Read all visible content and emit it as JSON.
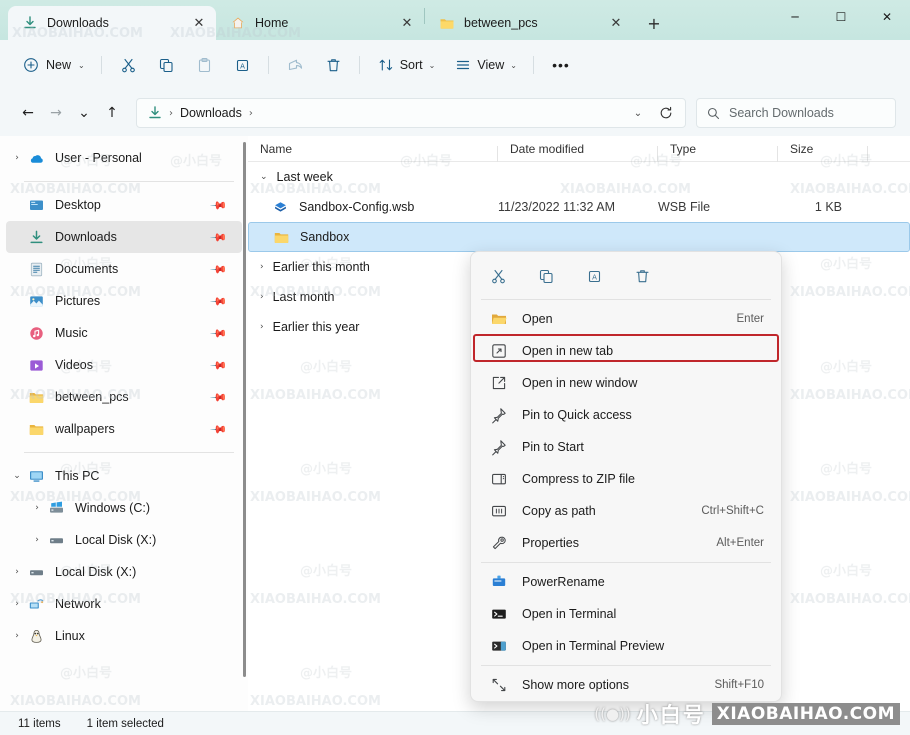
{
  "window": {
    "minimize_label": "─",
    "maximize_label": "☐",
    "close_label": "✕"
  },
  "tabs": [
    {
      "label": "Downloads",
      "icon": "download-icon",
      "active": true,
      "close_label": "✕"
    },
    {
      "label": "Home",
      "icon": "home-icon",
      "active": false,
      "close_label": "✕"
    },
    {
      "label": "between_pcs",
      "icon": "folder-icon",
      "active": false,
      "close_label": "✕"
    }
  ],
  "new_tab_label": "+",
  "toolbar": {
    "new_label": "New",
    "new_chevron": "⌄",
    "cut_label": "Cut",
    "copy_label": "Copy",
    "paste_label": "Paste",
    "rename_label": "Rename",
    "share_label": "Share",
    "delete_label": "Delete",
    "sort_label": "Sort",
    "sort_chevron": "⌄",
    "view_label": "View",
    "view_chevron": "⌄",
    "more_label": "•••"
  },
  "navbar": {
    "back_label": "←",
    "forward_label": "→",
    "recent_label": "⌄",
    "up_label": "↑",
    "refresh_label": "↻",
    "dropdown_label": "⌄"
  },
  "address": {
    "icon": "download-icon",
    "separator": "›",
    "crumbs": [
      "Downloads"
    ],
    "trailing_separator": "›"
  },
  "search": {
    "placeholder": "Search Downloads",
    "icon": "search-icon"
  },
  "sidebar": {
    "items": [
      {
        "label": "User - Personal",
        "icon": "onedrive-icon",
        "expander": "›",
        "indent": 0,
        "pinned": false,
        "selected": false
      },
      {
        "divider": true
      },
      {
        "label": "Desktop",
        "icon": "desktop-icon",
        "expander": "",
        "indent": 1,
        "pinned": true,
        "selected": false
      },
      {
        "label": "Downloads",
        "icon": "download-icon",
        "expander": "",
        "indent": 1,
        "pinned": true,
        "selected": true
      },
      {
        "label": "Documents",
        "icon": "documents-icon",
        "expander": "",
        "indent": 1,
        "pinned": true,
        "selected": false
      },
      {
        "label": "Pictures",
        "icon": "pictures-icon",
        "expander": "",
        "indent": 1,
        "pinned": true,
        "selected": false
      },
      {
        "label": "Music",
        "icon": "music-icon",
        "expander": "",
        "indent": 1,
        "pinned": true,
        "selected": false
      },
      {
        "label": "Videos",
        "icon": "videos-icon",
        "expander": "",
        "indent": 1,
        "pinned": true,
        "selected": false
      },
      {
        "label": "between_pcs",
        "icon": "folder-icon",
        "expander": "",
        "indent": 1,
        "pinned": true,
        "selected": false
      },
      {
        "label": "wallpapers",
        "icon": "folder-icon",
        "expander": "",
        "indent": 1,
        "pinned": true,
        "selected": false
      },
      {
        "divider": true
      },
      {
        "label": "This PC",
        "icon": "thispc-icon",
        "expander": "⌄",
        "indent": 0,
        "pinned": false,
        "selected": false
      },
      {
        "label": "Windows (C:)",
        "icon": "windrive-icon",
        "expander": "›",
        "indent": 1,
        "pinned": false,
        "selected": false
      },
      {
        "label": "Local Disk (X:)",
        "icon": "drive-icon",
        "expander": "›",
        "indent": 1,
        "pinned": false,
        "selected": false
      },
      {
        "label": "Local Disk (X:)",
        "icon": "drive-icon",
        "expander": "›",
        "indent": 0,
        "pinned": false,
        "selected": false
      },
      {
        "label": "Network",
        "icon": "network-icon",
        "expander": "›",
        "indent": 0,
        "pinned": false,
        "selected": false
      },
      {
        "label": "Linux",
        "icon": "linux-icon",
        "expander": "›",
        "indent": 0,
        "pinned": false,
        "selected": false
      }
    ]
  },
  "filelist": {
    "columns": [
      "Name",
      "Date modified",
      "Type",
      "Size"
    ],
    "groups": [
      {
        "label": "Last week",
        "expander": "⌄",
        "expanded": true,
        "rows": [
          {
            "name": "Sandbox-Config.wsb",
            "icon": "wsb-file-icon",
            "date": "11/23/2022 11:32 AM",
            "type": "WSB File",
            "size": "1 KB",
            "selected": false
          },
          {
            "name": "Sandbox",
            "icon": "folder-icon",
            "date": "",
            "type": "",
            "size": "",
            "selected": true
          }
        ]
      },
      {
        "label": "Earlier this month",
        "expander": "›",
        "expanded": false,
        "rows": []
      },
      {
        "label": "Last month",
        "expander": "›",
        "expanded": false,
        "rows": []
      },
      {
        "label": "Earlier this year",
        "expander": "›",
        "expanded": false,
        "rows": []
      }
    ]
  },
  "context_menu": {
    "icon_row": [
      {
        "name": "cut-icon",
        "label": "Cut"
      },
      {
        "name": "copy-icon",
        "label": "Copy"
      },
      {
        "name": "rename-icon",
        "label": "Rename"
      },
      {
        "name": "delete-icon",
        "label": "Delete"
      }
    ],
    "items": [
      {
        "label": "Open",
        "icon": "folder-open-icon",
        "shortcut": "Enter",
        "highlighted": false
      },
      {
        "label": "Open in new tab",
        "icon": "open-new-tab-icon",
        "shortcut": "",
        "highlighted": true
      },
      {
        "label": "Open in new window",
        "icon": "open-new-window-icon",
        "shortcut": "",
        "highlighted": false
      },
      {
        "label": "Pin to Quick access",
        "icon": "pin-icon",
        "shortcut": "",
        "highlighted": false
      },
      {
        "label": "Pin to Start",
        "icon": "pin-icon",
        "shortcut": "",
        "highlighted": false
      },
      {
        "label": "Compress to ZIP file",
        "icon": "zip-icon",
        "shortcut": "",
        "highlighted": false
      },
      {
        "label": "Copy as path",
        "icon": "copy-path-icon",
        "shortcut": "Ctrl+Shift+C",
        "highlighted": false
      },
      {
        "label": "Properties",
        "icon": "properties-icon",
        "shortcut": "Alt+Enter",
        "highlighted": false
      },
      {
        "separator": true
      },
      {
        "label": "PowerRename",
        "icon": "powerrename-icon",
        "shortcut": "",
        "highlighted": false
      },
      {
        "label": "Open in Terminal",
        "icon": "terminal-icon",
        "shortcut": "",
        "highlighted": false
      },
      {
        "label": "Open in Terminal Preview",
        "icon": "terminal-preview-icon",
        "shortcut": "",
        "highlighted": false
      },
      {
        "separator": true
      },
      {
        "label": "Show more options",
        "icon": "more-options-icon",
        "shortcut": "Shift+F10",
        "highlighted": false
      }
    ]
  },
  "statusbar": {
    "item_count": "11 items",
    "selection": "1 item selected"
  },
  "watermark": {
    "brand_cn": "小白号",
    "brand_en": "XIAOBAIHAO.COM",
    "brand_radio": "((●))",
    "tile_text": "XIAOBAIHAO.COM",
    "tile_cn": "@小白号"
  },
  "colors": {
    "titlebar": "#c6e6e0",
    "chrome": "#f3f7f9",
    "selection": "#cfe8fa",
    "highlight_box": "#c0262b",
    "accent": "#0f6cbd"
  }
}
